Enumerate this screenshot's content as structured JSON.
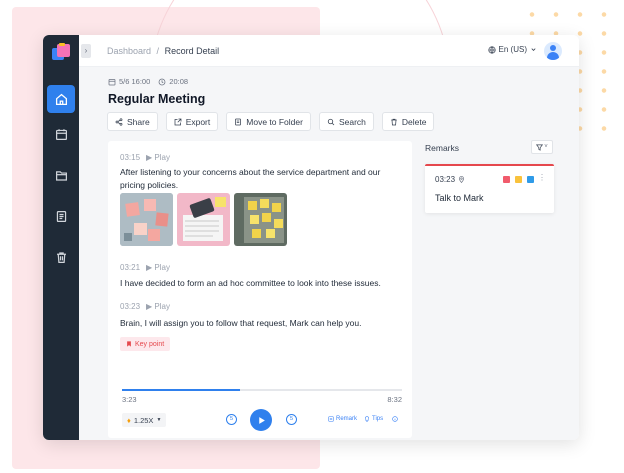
{
  "breadcrumb": {
    "root": "Dashboard",
    "separator": "/",
    "current": "Record Detail"
  },
  "header": {
    "language": "En (US)"
  },
  "sidebar": {
    "items": [
      {
        "icon": "home-icon"
      },
      {
        "icon": "calendar-icon"
      },
      {
        "icon": "folder-icon"
      },
      {
        "icon": "document-icon"
      },
      {
        "icon": "trash-icon"
      }
    ]
  },
  "record": {
    "date": "5/6 16:00",
    "duration": "20:08",
    "title": "Regular Meeting"
  },
  "toolbar": {
    "share": "Share",
    "export": "Export",
    "move": "Move to Folder",
    "search": "Search",
    "delete": "Delete"
  },
  "transcript": {
    "play_label": "Play",
    "segments": [
      {
        "time": "03:15",
        "text": "After listening to your concerns about the service department and our pricing policies."
      },
      {
        "time": "03:21",
        "text": "I have decided to form an ad hoc committee to look into these issues."
      },
      {
        "time": "03:23",
        "text": "Brain, I will assign you to follow that request, Mark can help you."
      }
    ],
    "key_point": "Key point"
  },
  "player": {
    "current": "3:23",
    "total": "8:32",
    "progress": 0.42,
    "speed": "1.25X",
    "skip_seconds": "5",
    "remark_link": "Remark",
    "tips_link": "Tips"
  },
  "remarks": {
    "label": "Remarks",
    "items": [
      {
        "time": "03:23",
        "text": "Talk to Mark",
        "colors": [
          "#f15b6c",
          "#f9c23c",
          "#2f9be8"
        ]
      }
    ]
  },
  "colors": {
    "accent": "#2f80ed",
    "sidebar": "#1f2a37",
    "danger": "#e5484d"
  }
}
